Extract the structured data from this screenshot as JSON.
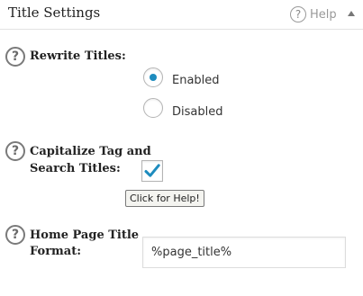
{
  "panel": {
    "title": "Title Settings",
    "help_label": "Help",
    "help_icon_glyph": "?"
  },
  "options": {
    "rewrite_titles": {
      "label": "Rewrite Titles:",
      "help_glyph": "?",
      "choices": [
        {
          "label": "Enabled",
          "selected": true
        },
        {
          "label": "Disabled",
          "selected": false
        }
      ]
    },
    "capitalize": {
      "label_line1": "Capitalize Tag and",
      "label_line2": "Search Titles:",
      "help_glyph": "?",
      "checked": true,
      "tooltip": "Click for Help!"
    },
    "home_page_title": {
      "label_line1": "Home Page Title",
      "label_line2": "Format:",
      "help_glyph": "?",
      "value": "%page_title%"
    }
  },
  "colors": {
    "accent": "#1e8cbe"
  }
}
